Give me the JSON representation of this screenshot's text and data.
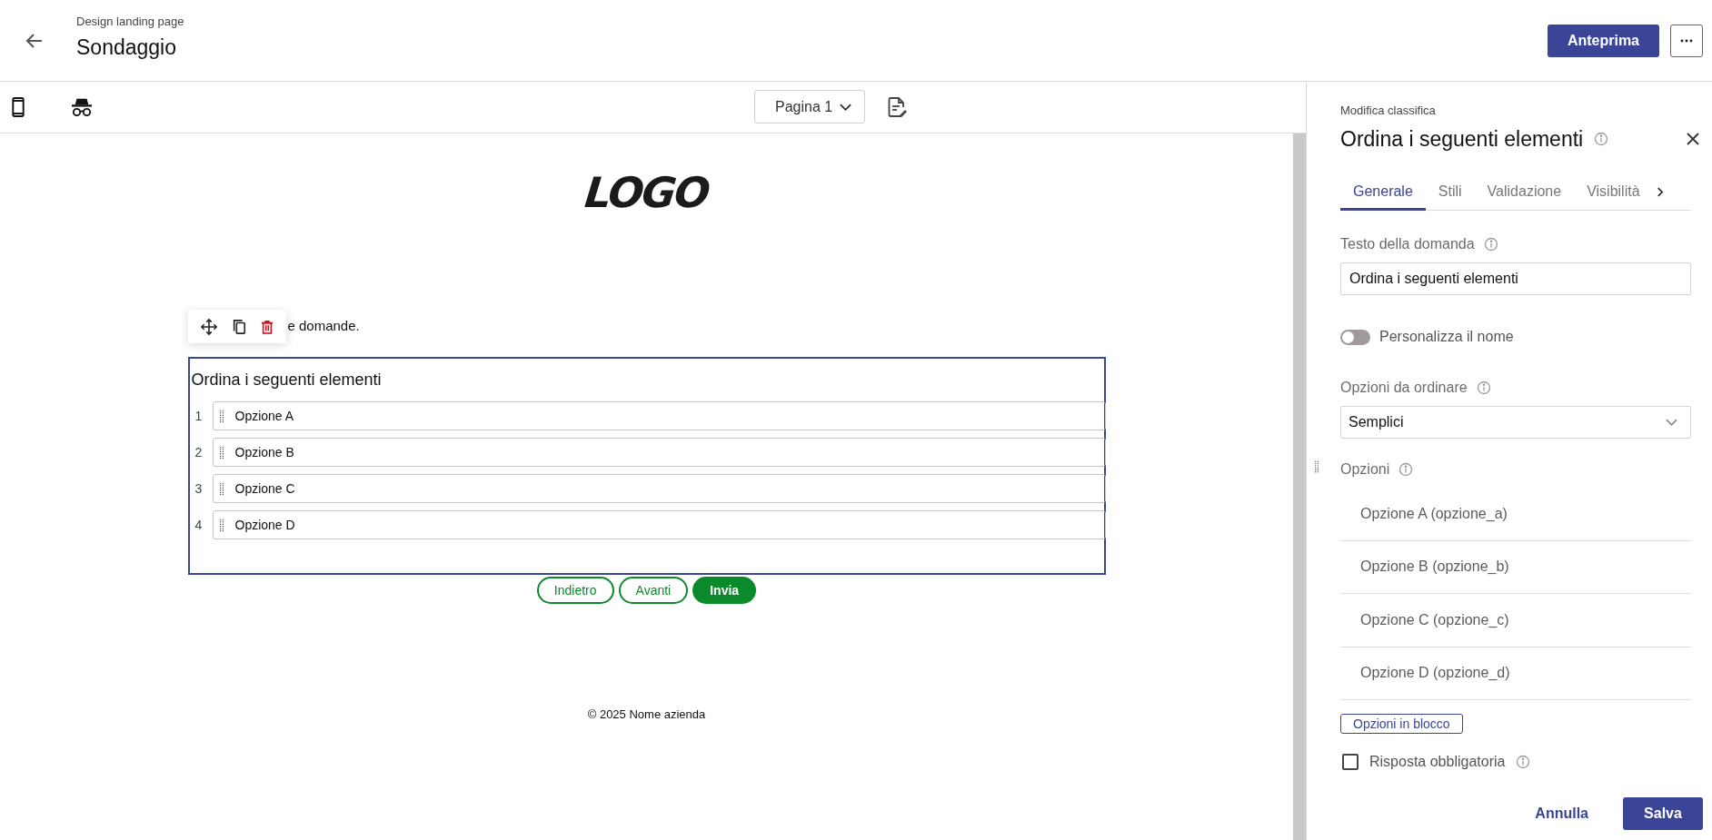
{
  "header": {
    "breadcrumb": "Design landing page",
    "title": "Sondaggio",
    "preview_button": "Anteprima"
  },
  "toolbar": {
    "page_select": "Pagina 1"
  },
  "canvas": {
    "logo": "LOGO",
    "intro_text": "e domande.",
    "question": {
      "title": "Ordina i seguenti elementi",
      "items": [
        {
          "number": "1",
          "label": "Opzione A"
        },
        {
          "number": "2",
          "label": "Opzione B"
        },
        {
          "number": "3",
          "label": "Opzione C"
        },
        {
          "number": "4",
          "label": "Opzione D"
        }
      ]
    },
    "nav_buttons": [
      {
        "label": "Indietro",
        "kind": "outline"
      },
      {
        "label": "Avanti",
        "kind": "outline"
      },
      {
        "label": "Invia",
        "kind": "filled"
      }
    ],
    "footer": "© 2025 Nome azienda"
  },
  "panel": {
    "subtitle": "Modifica classifica",
    "title": "Ordina i seguenti elementi",
    "tabs": [
      {
        "label": "Generale",
        "selected": true
      },
      {
        "label": "Stili",
        "selected": false
      },
      {
        "label": "Validazione",
        "selected": false
      },
      {
        "label": "Visibilità",
        "selected": false
      }
    ],
    "question_text": {
      "label": "Testo della domanda",
      "value": "Ordina i seguenti elementi"
    },
    "custom_name": {
      "label": "Personalizza il nome",
      "on": false
    },
    "order_options": {
      "label": "Opzioni da ordinare",
      "value": "Semplici"
    },
    "options": {
      "label": "Opzioni",
      "items": [
        "Opzione A (opzione_a)",
        "Opzione B (opzione_b)",
        "Opzione C (opzione_c)",
        "Opzione D (opzione_d)"
      ]
    },
    "bulk_button": "Opzioni in blocco",
    "required": {
      "label": "Risposta obbligatoria",
      "checked": false
    },
    "cancel_button": "Annulla",
    "save_button": "Salva"
  }
}
